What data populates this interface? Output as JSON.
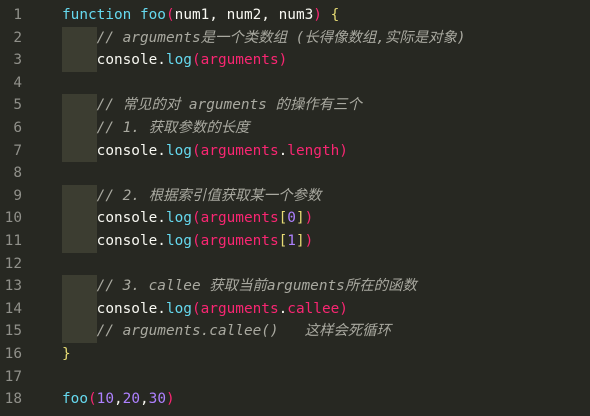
{
  "editor": {
    "lines": [
      {
        "n": "1",
        "tokens": [
          {
            "t": "function",
            "c": "blue"
          },
          {
            "t": " ",
            "c": "plain"
          },
          {
            "t": "foo",
            "c": "blue"
          },
          {
            "t": "(",
            "c": "paren"
          },
          {
            "t": "num1, num2, num3",
            "c": "plain"
          },
          {
            "t": ")",
            "c": "paren"
          },
          {
            "t": " ",
            "c": "plain"
          },
          {
            "t": "{",
            "c": "brace"
          }
        ]
      },
      {
        "n": "2",
        "guide": true,
        "tokens": [
          {
            "t": "    // arguments是一个类数组 (长得像数组,实际是对象)",
            "c": "comment"
          }
        ]
      },
      {
        "n": "3",
        "guide": true,
        "tokens": [
          {
            "t": "    console.",
            "c": "plain"
          },
          {
            "t": "log",
            "c": "blue"
          },
          {
            "t": "(",
            "c": "paren"
          },
          {
            "t": "arguments",
            "c": "pink"
          },
          {
            "t": ")",
            "c": "paren"
          }
        ]
      },
      {
        "n": "4",
        "tokens": []
      },
      {
        "n": "5",
        "guide": true,
        "tokens": [
          {
            "t": "    // 常见的对 arguments 的操作有三个",
            "c": "comment"
          }
        ]
      },
      {
        "n": "6",
        "guide": true,
        "tokens": [
          {
            "t": "    // 1. 获取参数的长度",
            "c": "comment"
          }
        ]
      },
      {
        "n": "7",
        "guide": true,
        "tokens": [
          {
            "t": "    console.",
            "c": "plain"
          },
          {
            "t": "log",
            "c": "blue"
          },
          {
            "t": "(",
            "c": "paren"
          },
          {
            "t": "arguments",
            "c": "pink"
          },
          {
            "t": ".",
            "c": "plain"
          },
          {
            "t": "length",
            "c": "pink"
          },
          {
            "t": ")",
            "c": "paren"
          }
        ]
      },
      {
        "n": "8",
        "tokens": []
      },
      {
        "n": "9",
        "guide": true,
        "tokens": [
          {
            "t": "    // 2. 根据索引值获取某一个参数",
            "c": "comment"
          }
        ]
      },
      {
        "n": "10",
        "guide": true,
        "tokens": [
          {
            "t": "    console.",
            "c": "plain"
          },
          {
            "t": "log",
            "c": "blue"
          },
          {
            "t": "(",
            "c": "paren"
          },
          {
            "t": "arguments",
            "c": "pink"
          },
          {
            "t": "[",
            "c": "brace"
          },
          {
            "t": "0",
            "c": "num"
          },
          {
            "t": "]",
            "c": "brace"
          },
          {
            "t": ")",
            "c": "paren"
          }
        ]
      },
      {
        "n": "11",
        "guide": true,
        "tokens": [
          {
            "t": "    console.",
            "c": "plain"
          },
          {
            "t": "log",
            "c": "blue"
          },
          {
            "t": "(",
            "c": "paren"
          },
          {
            "t": "arguments",
            "c": "pink"
          },
          {
            "t": "[",
            "c": "brace"
          },
          {
            "t": "1",
            "c": "num"
          },
          {
            "t": "]",
            "c": "brace"
          },
          {
            "t": ")",
            "c": "paren"
          }
        ]
      },
      {
        "n": "12",
        "tokens": []
      },
      {
        "n": "13",
        "guide": true,
        "tokens": [
          {
            "t": "    // 3. callee 获取当前arguments所在的函数",
            "c": "comment"
          }
        ]
      },
      {
        "n": "14",
        "guide": true,
        "tokens": [
          {
            "t": "    console.",
            "c": "plain"
          },
          {
            "t": "log",
            "c": "blue"
          },
          {
            "t": "(",
            "c": "paren"
          },
          {
            "t": "arguments",
            "c": "pink"
          },
          {
            "t": ".",
            "c": "plain"
          },
          {
            "t": "callee",
            "c": "pink"
          },
          {
            "t": ")",
            "c": "paren"
          }
        ]
      },
      {
        "n": "15",
        "guide": true,
        "tokens": [
          {
            "t": "    // arguments.callee()   这样会死循环",
            "c": "comment"
          }
        ]
      },
      {
        "n": "16",
        "tokens": [
          {
            "t": "}",
            "c": "brace"
          }
        ]
      },
      {
        "n": "17",
        "tokens": []
      },
      {
        "n": "18",
        "tokens": [
          {
            "t": "foo",
            "c": "blue"
          },
          {
            "t": "(",
            "c": "paren"
          },
          {
            "t": "10",
            "c": "num"
          },
          {
            "t": ",",
            "c": "plain"
          },
          {
            "t": "20",
            "c": "num"
          },
          {
            "t": ",",
            "c": "plain"
          },
          {
            "t": "30",
            "c": "num"
          },
          {
            "t": ")",
            "c": "paren"
          }
        ]
      }
    ]
  }
}
